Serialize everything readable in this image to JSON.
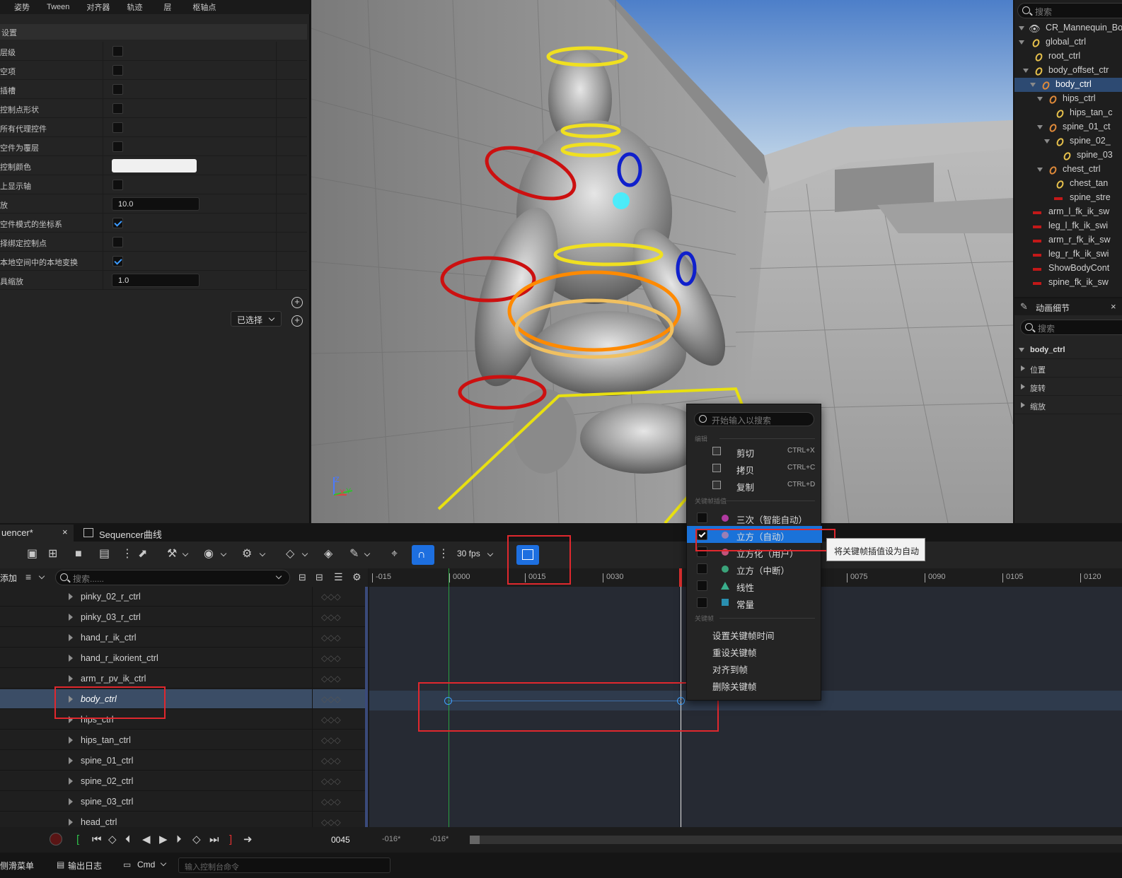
{
  "top_tabs": [
    "姿势",
    "Tween",
    "对齐器",
    "轨迹",
    "层",
    "枢轴点"
  ],
  "settings": {
    "header": "设置",
    "rows": [
      {
        "label": "层级",
        "type": "checkbox",
        "checked": false
      },
      {
        "label": "空项",
        "type": "checkbox",
        "checked": false
      },
      {
        "label": "插槽",
        "type": "checkbox",
        "checked": false
      },
      {
        "label": "控制点形状",
        "type": "checkbox",
        "checked": false
      },
      {
        "label": "所有代理控件",
        "type": "checkbox",
        "checked": false
      },
      {
        "label": "空件为覆层",
        "type": "checkbox",
        "checked": false
      },
      {
        "label": "控制颜色",
        "type": "color",
        "value": "#f0f0f0"
      },
      {
        "label": "上显示轴",
        "type": "checkbox",
        "checked": false
      },
      {
        "label": "放",
        "type": "number",
        "value": "10.0"
      },
      {
        "label": "空件模式的坐标系",
        "type": "checkbox",
        "checked": true
      },
      {
        "label": "择绑定控制点",
        "type": "checkbox",
        "checked": false
      },
      {
        "label": "本地空间中的本地变换",
        "type": "checkbox",
        "checked": true
      },
      {
        "label": "具缩放",
        "type": "number",
        "value": "1.0"
      }
    ],
    "selected_dropdown": "已选择"
  },
  "viewport": {
    "axis_labels": [
      "Z",
      "X",
      "Y"
    ]
  },
  "outliner": {
    "search_placeholder": "搜索",
    "items": [
      {
        "label": "CR_Mannequin_Bo",
        "icon": "eye-icon"
      },
      {
        "label": "global_ctrl",
        "icon": "control-ring-icon"
      },
      {
        "label": "root_ctrl",
        "icon": "control-ring-icon"
      },
      {
        "label": "body_offset_ctr",
        "icon": "control-ring-icon"
      },
      {
        "label": "body_ctrl",
        "icon": "control-ring-icon",
        "selected": true
      },
      {
        "label": "hips_ctrl",
        "icon": "control-ring-icon"
      },
      {
        "label": "hips_tan_c",
        "icon": "control-ring-icon"
      },
      {
        "label": "spine_01_ct",
        "icon": "control-ring-icon"
      },
      {
        "label": "spine_02_",
        "icon": "control-ring-icon"
      },
      {
        "label": "spine_03",
        "icon": "control-ring-icon"
      },
      {
        "label": "chest_ctrl",
        "icon": "control-ring-icon"
      },
      {
        "label": "chest_tan",
        "icon": "control-ring-icon"
      },
      {
        "label": "spine_stre",
        "icon": "bool-control-icon"
      },
      {
        "label": "arm_l_fk_ik_sw",
        "icon": "bool-control-icon"
      },
      {
        "label": "leg_l_fk_ik_swi",
        "icon": "bool-control-icon"
      },
      {
        "label": "arm_r_fk_ik_sw",
        "icon": "bool-control-icon"
      },
      {
        "label": "leg_r_fk_ik_swi",
        "icon": "bool-control-icon"
      },
      {
        "label": "ShowBodyCont",
        "icon": "bool-control-icon"
      },
      {
        "label": "spine_fk_ik_sw",
        "icon": "bool-control-icon"
      }
    ]
  },
  "anim_details": {
    "title": "动画细节",
    "search_placeholder": "搜索",
    "section": "body_ctrl",
    "rows": [
      "位置",
      "旋转",
      "缩放"
    ]
  },
  "sequencer": {
    "tabs": [
      "uencer*",
      "Sequencer曲线"
    ],
    "fps": "30 fps",
    "add_label": "添加",
    "search_placeholder": "搜索......",
    "tracks": [
      "pinky_02_r_ctrl",
      "pinky_03_r_ctrl",
      "hand_r_ik_ctrl",
      "hand_r_ikorient_ctrl",
      "arm_r_pv_ik_ctrl",
      "body_ctrl",
      "hips_ctrl",
      "hips_tan_ctrl",
      "spine_01_ctrl",
      "spine_02_ctrl",
      "spine_03_ctrl",
      "head_ctrl"
    ],
    "selected_track": "body_ctrl",
    "ruler_ticks": [
      "-015",
      "0000",
      "0015",
      "0030",
      "0075",
      "0090",
      "0105",
      "0120"
    ],
    "current_frame": "0045",
    "range_start": "-016*",
    "range_end": "-016*"
  },
  "status_bar": {
    "items": [
      "侧滑菜单",
      "输出日志",
      "Cmd"
    ],
    "console_placeholder": "输入控制台命令"
  },
  "context_menu": {
    "search_placeholder": "开始输入以搜索",
    "sections": {
      "edit": "编辑",
      "interp": "关键帧插值",
      "key": "关键帧"
    },
    "edit_items": [
      {
        "label": "剪切",
        "shortcut": "CTRL+X"
      },
      {
        "label": "拷贝",
        "shortcut": "CTRL+C"
      },
      {
        "label": "复制",
        "shortcut": "CTRL+D"
      }
    ],
    "interp_items": [
      {
        "label": "三次（智能自动）",
        "color": "#b03aa0",
        "checked": false
      },
      {
        "label": "立方（自动）",
        "color": "#9a7fb5",
        "checked": true
      },
      {
        "label": "立方化（用户）",
        "color": "#c4527a",
        "checked": false
      },
      {
        "label": "立方（中断）",
        "color": "#3aa37a",
        "checked": false
      },
      {
        "label": "线性",
        "color": "#3aae8c",
        "checked": false
      },
      {
        "label": "常量",
        "color": "#2a8fb0",
        "checked": false
      }
    ],
    "key_items": [
      "设置关键帧时间",
      "重设关键帧",
      "对齐到帧",
      "删除关键帧"
    ]
  },
  "tooltip": "将关键帧插值设为自动"
}
